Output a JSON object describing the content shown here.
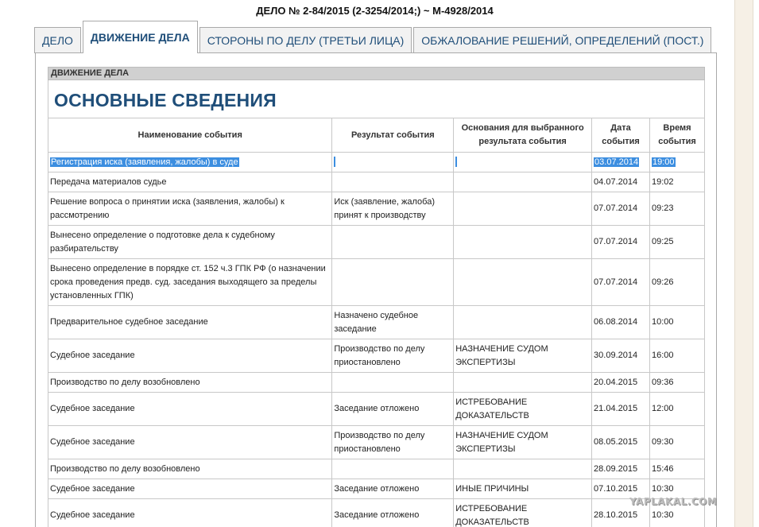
{
  "case_title": "ДЕЛО № 2-84/2015 (2-3254/2014;) ~ М-4928/2014",
  "tabs": [
    {
      "label": "ДЕЛО",
      "active": false
    },
    {
      "label": "ДВИЖЕНИЕ ДЕЛА",
      "active": true
    },
    {
      "label": "СТОРОНЫ ПО ДЕЛУ (ТРЕТЬИ ЛИЦА)",
      "active": false
    },
    {
      "label": "ОБЖАЛОВАНИЕ РЕШЕНИЙ, ОПРЕДЕЛЕНИЙ (ПОСТ.)",
      "active": false
    }
  ],
  "section": {
    "header": "ДВИЖЕНИЕ ДЕЛА",
    "title": "ОСНОВНЫЕ СВЕДЕНИЯ"
  },
  "table": {
    "columns": [
      "Наименование события",
      "Результат события",
      "Основания для выбранного результата события",
      "Дата события",
      "Время события"
    ],
    "rows": [
      {
        "event": "Регистрация иска (заявления, жалобы) в суде",
        "result": "",
        "basis": "",
        "date": "03.07.2014",
        "time": "19:00",
        "selected": true
      },
      {
        "event": "Передача материалов судье",
        "result": "",
        "basis": "",
        "date": "04.07.2014",
        "time": "19:02"
      },
      {
        "event": "Решение вопроса о принятии иска (заявления, жалобы) к рассмотрению",
        "result": "Иск (заявление, жалоба) принят к производству",
        "basis": "",
        "date": "07.07.2014",
        "time": "09:23"
      },
      {
        "event": "Вынесено определение о подготовке дела к судебному разбирательству",
        "result": "",
        "basis": "",
        "date": "07.07.2014",
        "time": "09:25"
      },
      {
        "event": "Вынесено определение в порядке ст. 152 ч.3 ГПК РФ (о назначении срока проведения предв. суд. заседания выходящего за пределы установленных ГПК)",
        "result": "",
        "basis": "",
        "date": "07.07.2014",
        "time": "09:26"
      },
      {
        "event": "Предварительное судебное заседание",
        "result": "Назначено судебное заседание",
        "basis": "",
        "date": "06.08.2014",
        "time": "10:00"
      },
      {
        "event": "Судебное заседание",
        "result": "Производство по делу приостановлено",
        "basis": "НАЗНАЧЕНИЕ СУДОМ ЭКСПЕРТИЗЫ",
        "date": "30.09.2014",
        "time": "16:00"
      },
      {
        "event": "Производство по делу возобновлено",
        "result": "",
        "basis": "",
        "date": "20.04.2015",
        "time": "09:36"
      },
      {
        "event": "Судебное заседание",
        "result": "Заседание отложено",
        "basis": "ИСТРЕБОВАНИЕ ДОКАЗАТЕЛЬСТВ",
        "date": "21.04.2015",
        "time": "12:00"
      },
      {
        "event": "Судебное заседание",
        "result": "Производство по делу приостановлено",
        "basis": "НАЗНАЧЕНИЕ СУДОМ ЭКСПЕРТИЗЫ",
        "date": "08.05.2015",
        "time": "09:30"
      },
      {
        "event": "Производство по делу возобновлено",
        "result": "",
        "basis": "",
        "date": "28.09.2015",
        "time": "15:46"
      },
      {
        "event": "Судебное заседание",
        "result": "Заседание отложено",
        "basis": "ИНЫЕ ПРИЧИНЫ",
        "date": "07.10.2015",
        "time": "10:30"
      },
      {
        "event": "Судебное заседание",
        "result": "Заседание отложено",
        "basis": "ИСТРЕБОВАНИЕ ДОКАЗАТЕЛЬСТВ",
        "date": "28.10.2015",
        "time": "10:30"
      }
    ]
  },
  "watermark": "YAPLAKAL.COM",
  "colors": {
    "accent": "#1f4e79",
    "selection": "#3c8ee0"
  }
}
